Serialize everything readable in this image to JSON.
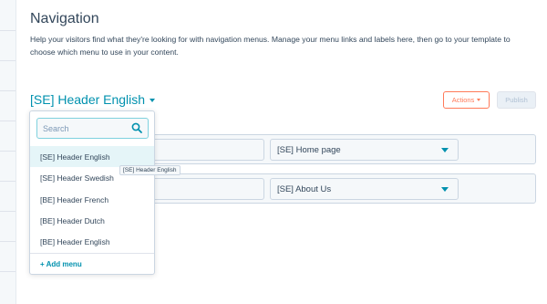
{
  "header": {
    "title": "Navigation",
    "description": "Help your visitors find what they're looking for with navigation menus. Manage your menu links and labels here, then go to your template to choose which menu to use in your content."
  },
  "menu_selector": {
    "current": "[SE] Header English"
  },
  "toolbar": {
    "actions_label": "Actions",
    "publish_label": "Publish"
  },
  "menu_items": [
    {
      "page": "[SE] Home page"
    },
    {
      "page": "[SE] About Us"
    }
  ],
  "dropdown": {
    "search_placeholder": "Search",
    "options": [
      "[SE] Header English",
      "[SE] Header Swedish",
      "[BE] Header French",
      "[BE] Header Dutch",
      "[BE] Header English"
    ],
    "add_menu_label": "+ Add menu"
  },
  "tooltip": {
    "text": "[SE] Header English"
  },
  "colors": {
    "accent": "#0091ae",
    "actions": "#ff7a59",
    "text": "#33475b"
  },
  "icons": {
    "search": "search-icon",
    "caret": "caret-down-icon"
  }
}
